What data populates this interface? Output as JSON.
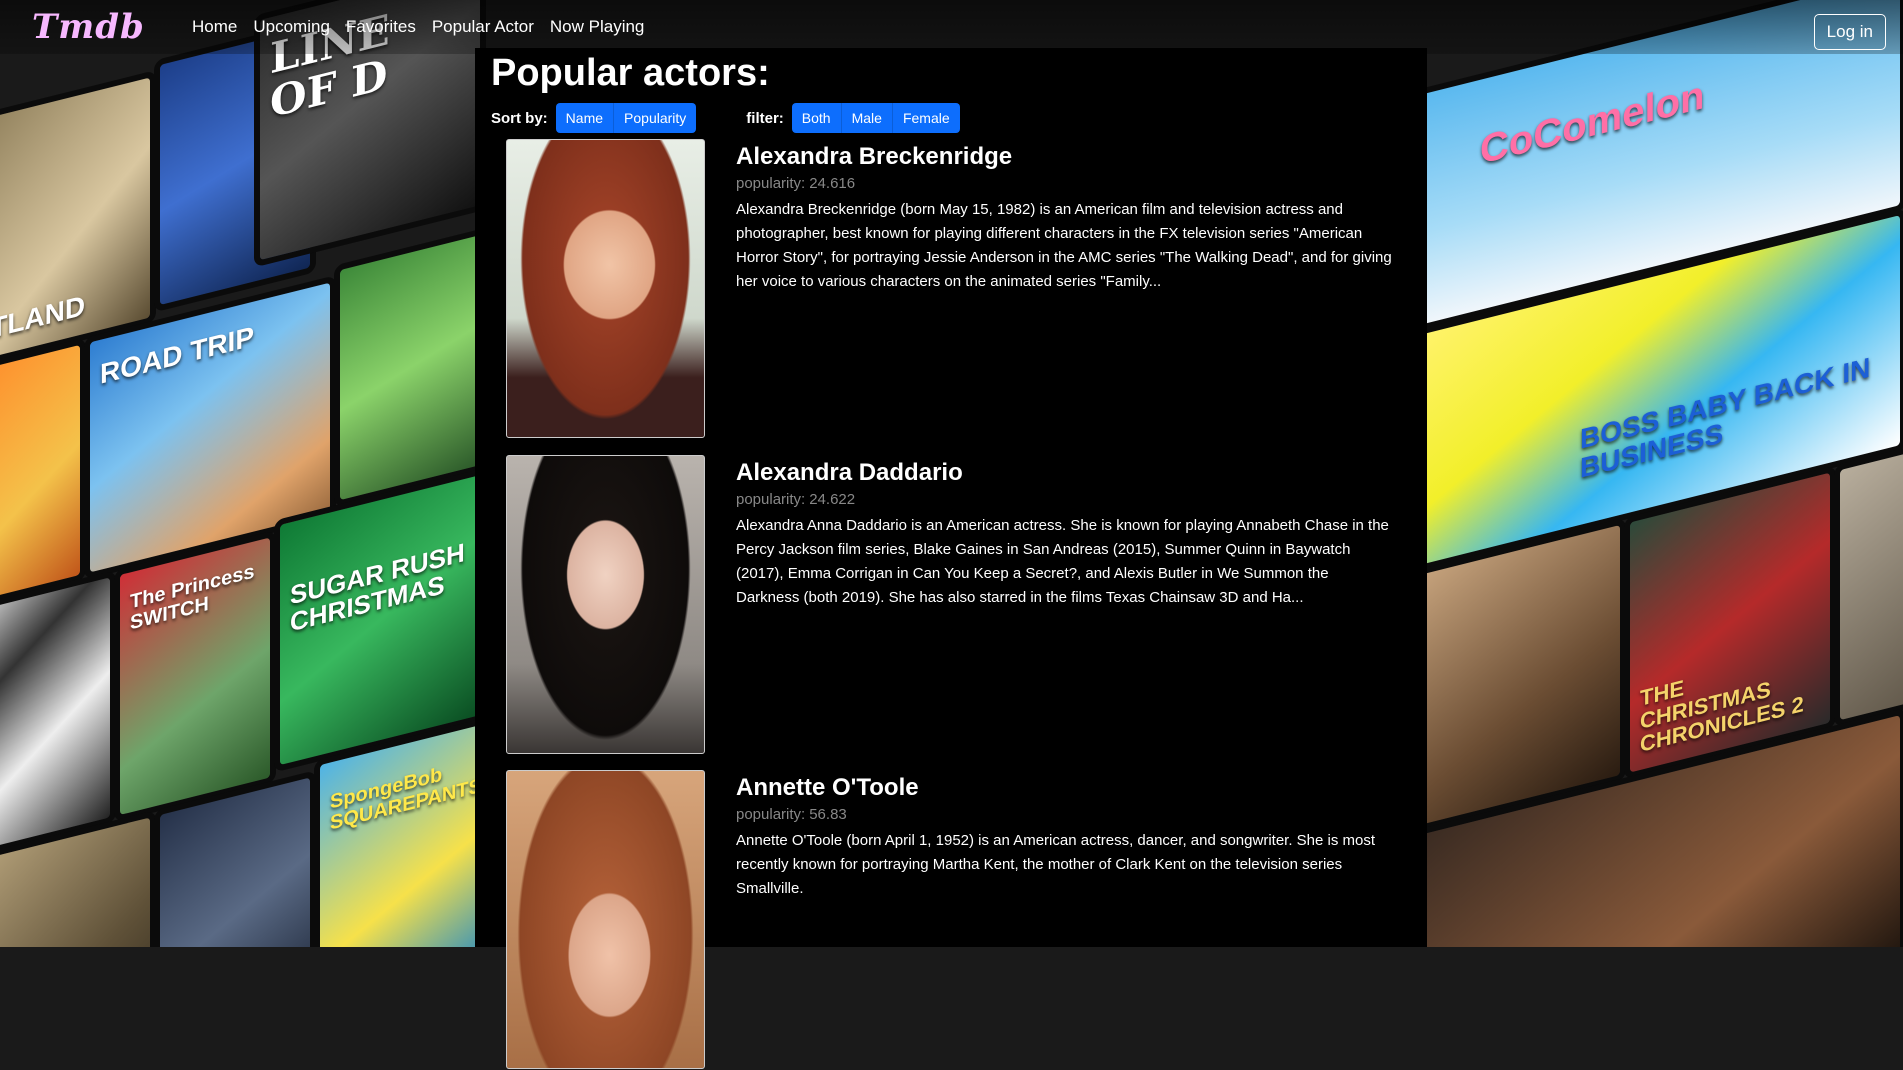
{
  "navbar": {
    "brand": "Tmdb",
    "links": [
      "Home",
      "Upcoming",
      "Favorites",
      "Popular Actor",
      "Now Playing"
    ],
    "login_label": "Log in"
  },
  "page": {
    "title": "Popular actors:",
    "sort_label": "Sort by:",
    "sort_options": [
      "Name",
      "Popularity"
    ],
    "filter_label": "filter:",
    "filter_options": [
      "Both",
      "Male",
      "Female"
    ]
  },
  "actors": [
    {
      "name": "Alexandra Breckenridge",
      "popularity_label": "popularity:",
      "popularity": "24.616",
      "bio": "Alexandra Breckenridge (born May 15, 1982) is an American film and television actress and photographer, best known for playing different characters in the FX television series \"American Horror Story\", for portraying Jessie Anderson in the AMC series \"The Walking Dead\", and for giving her voice to various characters on the animated series \"Family..."
    },
    {
      "name": "Alexandra Daddario",
      "popularity_label": "popularity:",
      "popularity": "24.622",
      "bio": "Alexandra Anna Daddario is an American actress. She is known for playing Annabeth Chase in the Percy Jackson film series, Blake Gaines in San Andreas (2015), Summer Quinn in Baywatch (2017), Emma Corrigan in Can You Keep a Secret?, and Alexis Butler in We Summon the Darkness (both 2019). She has also starred in the films Texas Chainsaw 3D and Ha..."
    },
    {
      "name": "Annette O'Toole",
      "popularity_label": "popularity:",
      "popularity": "56.83",
      "bio": "Annette O'Toole (born April 1, 1952) is an American actress, dancer, and songwriter. She is most recently known for portraying Martha Kent, the mother of Clark Kent on the television series Smallville."
    }
  ],
  "background_posters": {
    "left": [
      "RTLAND",
      "LINE OF D",
      "ROAD TRIP",
      "The Princess SWITCH",
      "SUGAR RUSH CHRISTMAS",
      "SpongeBob SQUAREPANTS"
    ],
    "right": [
      "CoComelon",
      "BOSS BABY BACK IN BUSINESS",
      "THE CHRISTMAS CHRONICLES 2"
    ]
  },
  "colors": {
    "accent": "#0d6efd",
    "brand": "#f7b8ff",
    "panel": "#000000",
    "muted": "#888888"
  }
}
